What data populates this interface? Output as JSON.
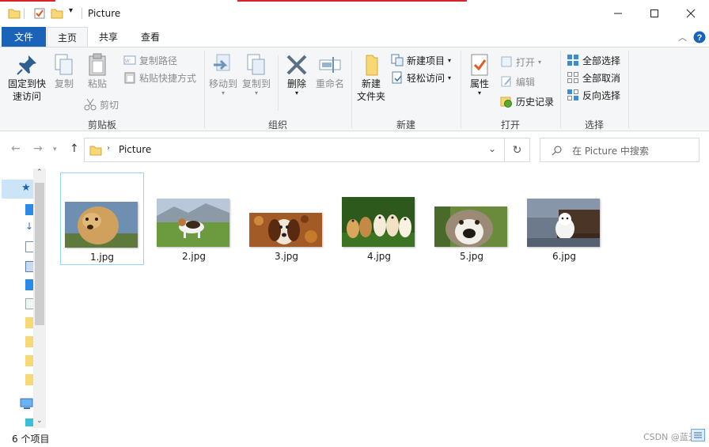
{
  "window": {
    "title": "Picture",
    "minimize_icon": "minimize-icon",
    "maximize_icon": "maximize-icon",
    "close_icon": "close-icon"
  },
  "ribbon_tabs": [
    "文件",
    "主页",
    "共享",
    "查看"
  ],
  "ribbon": {
    "clipboard": {
      "label": "剪贴板",
      "pin": "固定到快\n速访问",
      "copy": "复制",
      "paste": "粘贴",
      "copy_path": "复制路径",
      "paste_shortcut": "粘贴快捷方式",
      "cut": "剪切"
    },
    "organize": {
      "label": "组织",
      "move_to": "移动到",
      "copy_to": "复制到",
      "delete": "删除",
      "rename": "重命名"
    },
    "new": {
      "label": "新建",
      "new_folder": "新建\n文件夹",
      "new_item": "新建项目",
      "easy_access": "轻松访问"
    },
    "open": {
      "label": "打开",
      "properties": "属性",
      "open": "打开",
      "edit": "编辑",
      "history": "历史记录"
    },
    "select": {
      "label": "选择",
      "select_all": "全部选择",
      "select_none": "全部取消",
      "invert": "反向选择"
    }
  },
  "address": {
    "path": "Picture",
    "search_placeholder": "在 Picture 中搜索"
  },
  "files": [
    {
      "name": "1.jpg",
      "selected": true
    },
    {
      "name": "2.jpg",
      "selected": false
    },
    {
      "name": "3.jpg",
      "selected": false
    },
    {
      "name": "4.jpg",
      "selected": false
    },
    {
      "name": "5.jpg",
      "selected": false
    },
    {
      "name": "6.jpg",
      "selected": false
    }
  ],
  "status": {
    "count": "6 个项目",
    "watermark": "CSDN @蓝天"
  },
  "colors": {
    "accent": "#1a63b8",
    "selection": "#99d1ff",
    "folder": "#f8d775"
  }
}
